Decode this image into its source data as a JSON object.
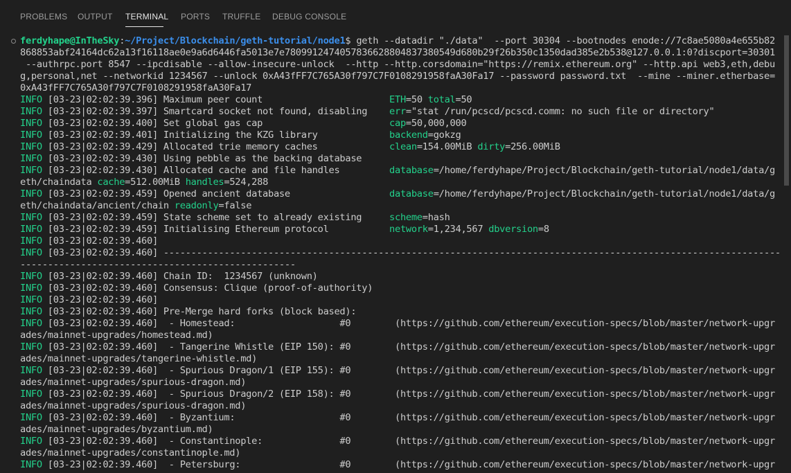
{
  "tabs": [
    "PROBLEMS",
    "OUTPUT",
    "TERMINAL",
    "PORTS",
    "TRUFFLE",
    "DEBUG CONSOLE"
  ],
  "active_tab": "TERMINAL",
  "prompt": {
    "user": "ferdyhape@InTheSky",
    "sep": ":",
    "path": "~/Project/Blockchain/geth-tutorial/node1",
    "symbol": "$ "
  },
  "command_lines": [
    "geth --datadir \"./data\"  --port 30304 --bootnodes enode://7c8ae5080a4e655b82",
    "868853abf24164dc62a13f16118ae0e9a6d6446fa5013e7e7809912474057836628804837380549d680b29f26b350c1350dad385e2b538@127.0.0.1:0?discport=30301",
    " --authrpc.port 8547 --ipcdisable --allow-insecure-unlock  --http --http.corsdomain=\"https://remix.ethereum.org\" --http.api web3,eth,debu",
    "g,personal,net --networkid 1234567 --unlock 0xA43fFF7C765A30f797C7F0108291958faA30Fa17 --password password.txt  --mine --miner.etherbase=",
    "0xA43fFF7C765A30f797C7F0108291958faA30Fa17"
  ],
  "log_lines": [
    {
      "level": "INFO",
      "text": " [03-23|02:02:39.396] Maximum peer count                       ",
      "kv": [
        {
          "k": "ETH",
          "v": "=50 "
        },
        {
          "k": "total",
          "v": "=50"
        }
      ]
    },
    {
      "level": "INFO",
      "text": " [03-23|02:02:39.397] Smartcard socket not found, disabling    ",
      "kv": [
        {
          "k": "err",
          "v": "=\"stat /run/pcscd/pcscd.comm: no such file or directory\""
        }
      ]
    },
    {
      "level": "INFO",
      "text": " [03-23|02:02:39.400] Set global gas cap                       ",
      "kv": [
        {
          "k": "cap",
          "v": "=50,000,000"
        }
      ]
    },
    {
      "level": "INFO",
      "text": " [03-23|02:02:39.401] Initializing the KZG library             ",
      "kv": [
        {
          "k": "backend",
          "v": "=gokzg"
        }
      ]
    },
    {
      "level": "INFO",
      "text": " [03-23|02:02:39.429] Allocated trie memory caches             ",
      "kv": [
        {
          "k": "clean",
          "v": "=154.00MiB "
        },
        {
          "k": "dirty",
          "v": "=256.00MiB"
        }
      ]
    },
    {
      "level": "INFO",
      "text": " [03-23|02:02:39.430] Using pebble as the backing database",
      "kv": []
    },
    {
      "level": "INFO",
      "text": " [03-23|02:02:39.430] Allocated cache and file handles         ",
      "kv": [
        {
          "k": "database",
          "v": "=/home/ferdyhape/Project/Blockchain/geth-tutorial/node1/data/g"
        }
      ]
    },
    {
      "level": "",
      "text": "eth/chaindata ",
      "kv": [
        {
          "k": "cache",
          "v": "=512.00MiB "
        },
        {
          "k": "handles",
          "v": "=524,288"
        }
      ]
    },
    {
      "level": "INFO",
      "text": " [03-23|02:02:39.459] Opened ancient database                  ",
      "kv": [
        {
          "k": "database",
          "v": "=/home/ferdyhape/Project/Blockchain/geth-tutorial/node1/data/g"
        }
      ]
    },
    {
      "level": "",
      "text": "eth/chaindata/ancient/chain ",
      "kv": [
        {
          "k": "readonly",
          "v": "=false"
        }
      ]
    },
    {
      "level": "INFO",
      "text": " [03-23|02:02:39.459] State scheme set to already existing     ",
      "kv": [
        {
          "k": "scheme",
          "v": "=hash"
        }
      ]
    },
    {
      "level": "INFO",
      "text": " [03-23|02:02:39.459] Initialising Ethereum protocol           ",
      "kv": [
        {
          "k": "network",
          "v": "=1,234,567 "
        },
        {
          "k": "dbversion",
          "v": "=8"
        }
      ]
    },
    {
      "level": "INFO",
      "text": " [03-23|02:02:39.460]",
      "kv": []
    },
    {
      "level": "INFO",
      "text": " [03-23|02:02:39.460] ----------------------------------------------------------------------------------------------------------------",
      "kv": []
    },
    {
      "level": "",
      "text": "--------------------------------------------------",
      "kv": []
    },
    {
      "level": "INFO",
      "text": " [03-23|02:02:39.460] Chain ID:  1234567 (unknown)",
      "kv": []
    },
    {
      "level": "INFO",
      "text": " [03-23|02:02:39.460] Consensus: Clique (proof-of-authority)",
      "kv": []
    },
    {
      "level": "INFO",
      "text": " [03-23|02:02:39.460]",
      "kv": []
    },
    {
      "level": "INFO",
      "text": " [03-23|02:02:39.460] Pre-Merge hard forks (block based):",
      "kv": []
    },
    {
      "level": "INFO",
      "text": " [03-23|02:02:39.460]  - Homestead:                   #0        (https://github.com/ethereum/execution-specs/blob/master/network-upgr",
      "kv": []
    },
    {
      "level": "",
      "text": "ades/mainnet-upgrades/homestead.md)",
      "kv": []
    },
    {
      "level": "INFO",
      "text": " [03-23|02:02:39.460]  - Tangerine Whistle (EIP 150): #0        (https://github.com/ethereum/execution-specs/blob/master/network-upgr",
      "kv": []
    },
    {
      "level": "",
      "text": "ades/mainnet-upgrades/tangerine-whistle.md)",
      "kv": []
    },
    {
      "level": "INFO",
      "text": " [03-23|02:02:39.460]  - Spurious Dragon/1 (EIP 155): #0        (https://github.com/ethereum/execution-specs/blob/master/network-upgr",
      "kv": []
    },
    {
      "level": "",
      "text": "ades/mainnet-upgrades/spurious-dragon.md)",
      "kv": []
    },
    {
      "level": "INFO",
      "text": " [03-23|02:02:39.460]  - Spurious Dragon/2 (EIP 158): #0        (https://github.com/ethereum/execution-specs/blob/master/network-upgr",
      "kv": []
    },
    {
      "level": "",
      "text": "ades/mainnet-upgrades/spurious-dragon.md)",
      "kv": []
    },
    {
      "level": "INFO",
      "text": " [03-23|02:02:39.460]  - Byzantium:                   #0        (https://github.com/ethereum/execution-specs/blob/master/network-upgr",
      "kv": []
    },
    {
      "level": "",
      "text": "ades/mainnet-upgrades/byzantium.md)",
      "kv": []
    },
    {
      "level": "INFO",
      "text": " [03-23|02:02:39.460]  - Constantinople:              #0        (https://github.com/ethereum/execution-specs/blob/master/network-upgr",
      "kv": []
    },
    {
      "level": "",
      "text": "ades/mainnet-upgrades/constantinople.md)",
      "kv": []
    },
    {
      "level": "INFO",
      "text": " [03-23|02:02:39.460]  - Petersburg:                  #0        (https://github.com/ethereum/execution-specs/blob/master/network-upgr",
      "kv": []
    }
  ],
  "colors": {
    "background": "#1f1f1f",
    "text": "#cccccc",
    "green": "#23d18b",
    "blue": "#3b8eea"
  }
}
